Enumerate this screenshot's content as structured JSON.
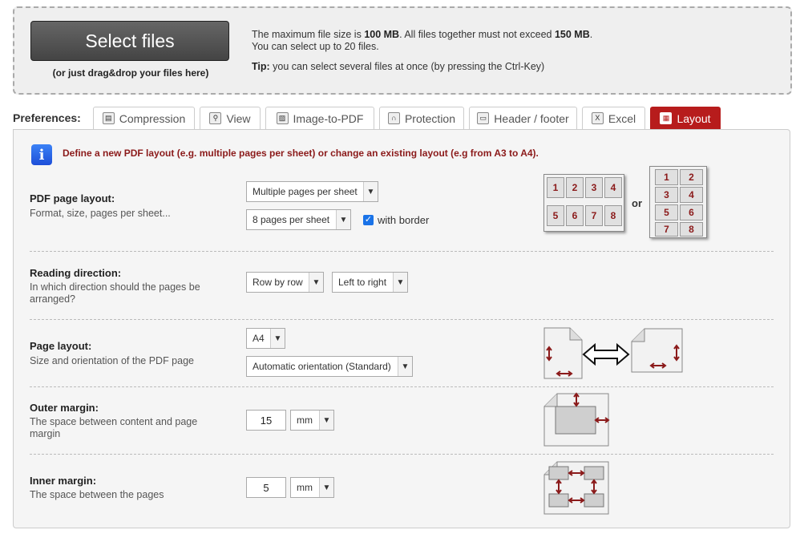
{
  "upload": {
    "button_label": "Select files",
    "drag_hint": "(or just drag&drop your files here)",
    "line1_pre": "The maximum file size is ",
    "line1_b1": "100 MB",
    "line1_mid": ". All files together must not exceed ",
    "line1_b2": "150 MB",
    "line1_post": ".",
    "line2": "You can select up to 20 files.",
    "tip_label": "Tip:",
    "tip_text": " you can select several files at once (by pressing the Ctrl-Key)"
  },
  "preferences_label": "Preferences:",
  "tabs": [
    {
      "label": "Compression",
      "icon": "compression-icon"
    },
    {
      "label": "View",
      "icon": "magnifier-icon"
    },
    {
      "label": "Image-to-PDF",
      "icon": "image-icon"
    },
    {
      "label": "Protection",
      "icon": "lock-icon"
    },
    {
      "label": "Header / footer",
      "icon": "header-footer-icon"
    },
    {
      "label": "Excel",
      "icon": "excel-icon"
    },
    {
      "label": "Layout",
      "icon": "layout-icon"
    }
  ],
  "active_tab": "Layout",
  "colors": {
    "accent": "#b71c1c",
    "intro_text": "#8b1a1a",
    "checkbox": "#1a73e8"
  },
  "intro": "Define a new PDF layout (e.g. multiple pages per sheet) or change an existing layout (e.g from A3 to A4).",
  "sections": {
    "pdf_layout": {
      "title": "PDF page layout:",
      "desc": "Format, size, pages per sheet...",
      "select1": "Multiple pages per sheet",
      "select2": "8 pages per sheet",
      "with_border_label": "with border",
      "with_border_checked": true,
      "or_label": "or",
      "grid_landscape": [
        "1",
        "2",
        "3",
        "4",
        "5",
        "6",
        "7",
        "8"
      ],
      "grid_portrait": [
        "1",
        "2",
        "3",
        "4",
        "5",
        "6",
        "7",
        "8"
      ]
    },
    "reading_direction": {
      "title": "Reading direction:",
      "desc": "In which direction should the pages be arranged?",
      "select1": "Row by row",
      "select2": "Left to right"
    },
    "page_layout": {
      "title": "Page layout:",
      "desc": "Size and orientation of the PDF page",
      "select1": "A4",
      "select2": "Automatic orientation (Standard)"
    },
    "outer_margin": {
      "title": "Outer margin:",
      "desc": "The space between content and page margin",
      "value": "15",
      "unit": "mm"
    },
    "inner_margin": {
      "title": "Inner margin:",
      "desc": "The space between the pages",
      "value": "5",
      "unit": "mm"
    }
  }
}
